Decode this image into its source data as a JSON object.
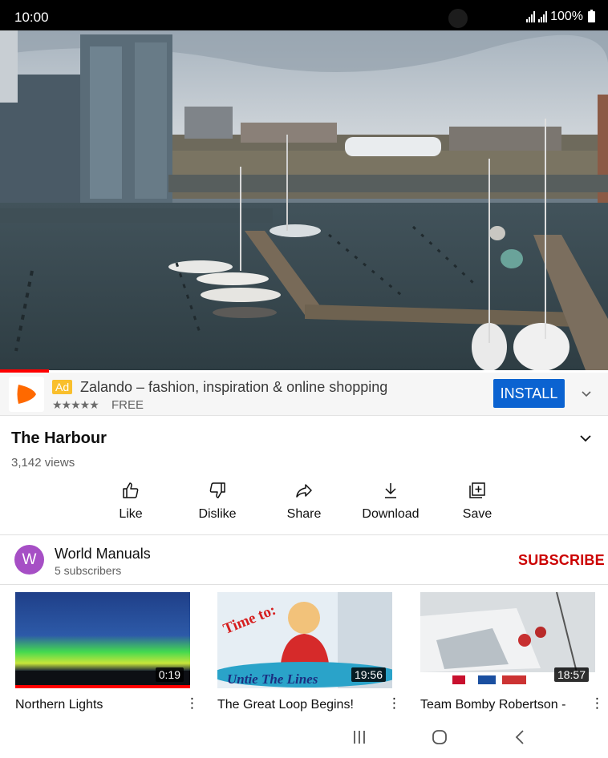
{
  "status_bar": {
    "time": "10:00",
    "battery": "100%"
  },
  "player": {
    "progress_fraction": 0.08
  },
  "ad": {
    "badge": "Ad",
    "title": "Zalando – fashion, inspiration & online shopping",
    "stars": "★★★★★",
    "price": "FREE",
    "install_label": "INSTALL",
    "brand_color": "#ff6900"
  },
  "video": {
    "title": "The Harbour",
    "views": "3,142 views"
  },
  "actions": [
    {
      "label": "Like",
      "icon": "thumbs-up-icon"
    },
    {
      "label": "Dislike",
      "icon": "thumbs-down-icon"
    },
    {
      "label": "Share",
      "icon": "share-icon"
    },
    {
      "label": "Download",
      "icon": "download-icon"
    },
    {
      "label": "Save",
      "icon": "add-to-playlist-icon"
    }
  ],
  "channel": {
    "avatar_letter": "W",
    "name": "World Manuals",
    "subscribers": "5 subscribers",
    "subscribe_label": "SUBSCRIBE"
  },
  "related": [
    {
      "title": "Northern Lights",
      "duration": "0:19",
      "watched_fraction": 1.0
    },
    {
      "title": "The Great Loop Begins!",
      "duration": "19:56",
      "thumb_text_1": "Time to:",
      "thumb_text_2": "Untie The Lines"
    },
    {
      "title": "Team Bomby Robertson -",
      "duration": "18:57"
    }
  ],
  "colors": {
    "accent_red": "#ff0000",
    "install_blue": "#0b63d1",
    "subscribe_red": "#cc0000"
  }
}
